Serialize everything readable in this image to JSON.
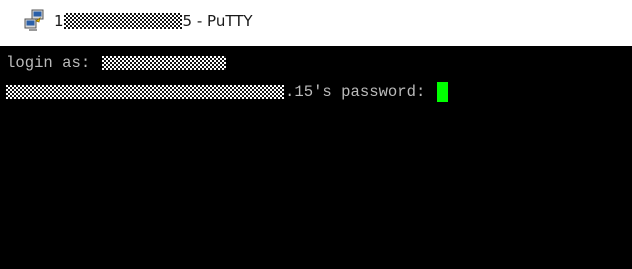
{
  "window": {
    "title_prefix": "1",
    "title_suffix": "5 - PuTTY",
    "app_icon": "putty-icon"
  },
  "terminal": {
    "login_prompt": "login as: ",
    "password_prompt": ".15's password: ",
    "cursor_color": "#00ff00",
    "background_color": "#000000",
    "text_color": "#bbbbbb"
  }
}
